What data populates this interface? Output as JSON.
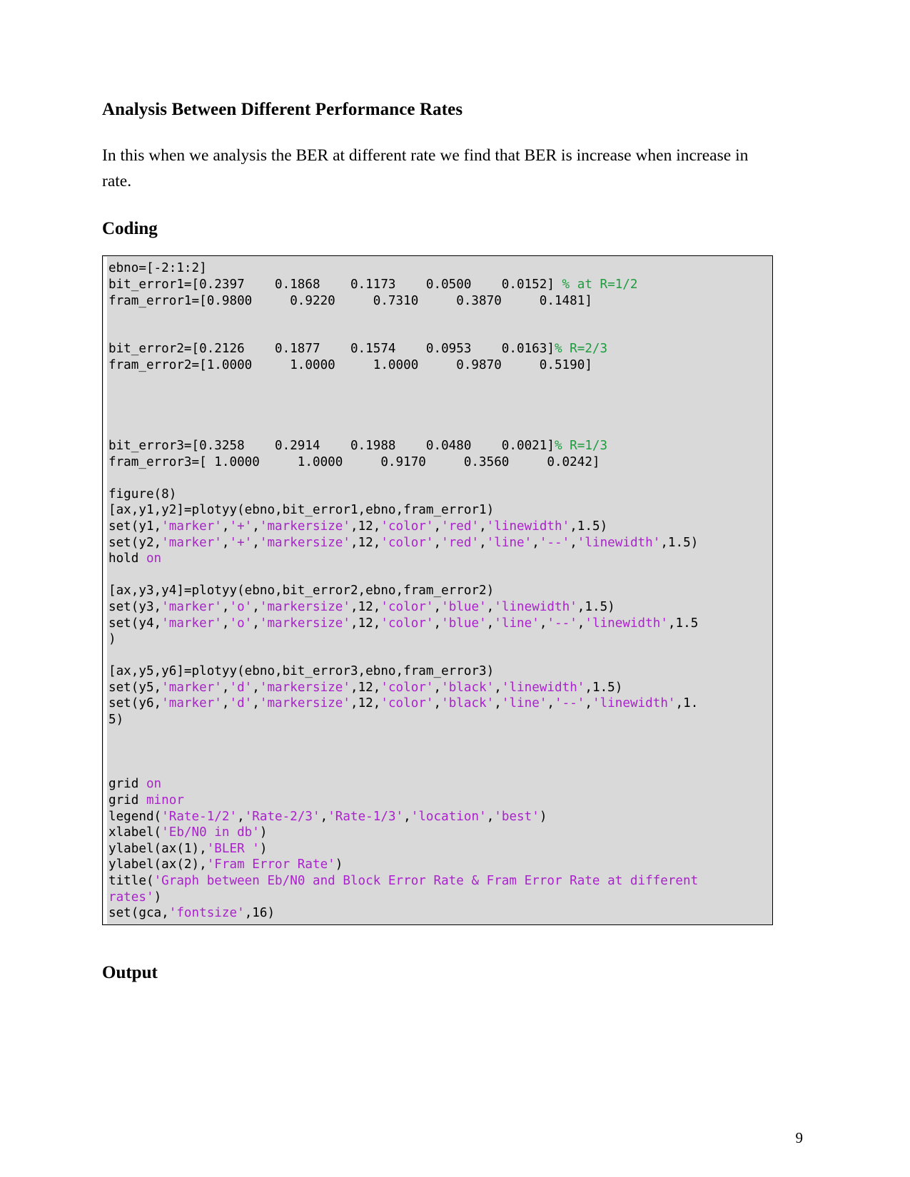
{
  "document": {
    "heading": "Analysis Between Different Performance Rates",
    "paragraph": "In this when we analysis the BER at different rate we find that BER is increase when increase in rate.",
    "coding_heading": "Coding",
    "output_heading": "Output",
    "page_number": "9"
  },
  "code": {
    "language": "matlab",
    "colors": {
      "background": "#d9d9d9",
      "border": "#000000",
      "plain": "#000000",
      "string": "#aa22cc",
      "comment": "#1f9a3f",
      "keyword": "#aa22cc"
    },
    "lines": [
      [
        {
          "t": "ebno=[-2:1:2]",
          "c": "pln"
        }
      ],
      [
        {
          "t": "bit_error1=[0.2397    0.1868    0.1173    0.0500    0.0152] ",
          "c": "pln"
        },
        {
          "t": "% at R=1/2",
          "c": "com"
        }
      ],
      [
        {
          "t": "fram_error1=[0.9800     0.9220     0.7310     0.3870     0.1481]",
          "c": "pln"
        }
      ],
      [
        {
          "t": "",
          "c": "pln"
        }
      ],
      [
        {
          "t": "",
          "c": "pln"
        }
      ],
      [
        {
          "t": "bit_error2=[0.2126    0.1877    0.1574    0.0953    0.0163]",
          "c": "pln"
        },
        {
          "t": "% R=2/3",
          "c": "com"
        }
      ],
      [
        {
          "t": "fram_error2=[1.0000     1.0000     1.0000     0.9870     0.5190]",
          "c": "pln"
        }
      ],
      [
        {
          "t": "",
          "c": "pln"
        }
      ],
      [
        {
          "t": "",
          "c": "pln"
        }
      ],
      [
        {
          "t": "",
          "c": "pln"
        }
      ],
      [
        {
          "t": "",
          "c": "pln"
        }
      ],
      [
        {
          "t": "bit_error3=[0.3258    0.2914    0.1988    0.0480    0.0021]",
          "c": "pln"
        },
        {
          "t": "% R=1/3",
          "c": "com"
        }
      ],
      [
        {
          "t": "fram_error3=[ 1.0000     1.0000     0.9170     0.3560     0.0242]",
          "c": "pln"
        }
      ],
      [
        {
          "t": "",
          "c": "pln"
        }
      ],
      [
        {
          "t": "figure(8)",
          "c": "pln"
        }
      ],
      [
        {
          "t": "[ax,y1,y2]=plotyy(ebno,bit_error1,ebno,fram_error1)",
          "c": "pln"
        }
      ],
      [
        {
          "t": "set(y1,",
          "c": "pln"
        },
        {
          "t": "'marker'",
          "c": "str"
        },
        {
          "t": ",",
          "c": "pln"
        },
        {
          "t": "'+'",
          "c": "str"
        },
        {
          "t": ",",
          "c": "pln"
        },
        {
          "t": "'markersize'",
          "c": "str"
        },
        {
          "t": ",12,",
          "c": "pln"
        },
        {
          "t": "'color'",
          "c": "str"
        },
        {
          "t": ",",
          "c": "pln"
        },
        {
          "t": "'red'",
          "c": "str"
        },
        {
          "t": ",",
          "c": "pln"
        },
        {
          "t": "'linewidth'",
          "c": "str"
        },
        {
          "t": ",1.5)",
          "c": "pln"
        }
      ],
      [
        {
          "t": "set(y2,",
          "c": "pln"
        },
        {
          "t": "'marker'",
          "c": "str"
        },
        {
          "t": ",",
          "c": "pln"
        },
        {
          "t": "'+'",
          "c": "str"
        },
        {
          "t": ",",
          "c": "pln"
        },
        {
          "t": "'markersize'",
          "c": "str"
        },
        {
          "t": ",12,",
          "c": "pln"
        },
        {
          "t": "'color'",
          "c": "str"
        },
        {
          "t": ",",
          "c": "pln"
        },
        {
          "t": "'red'",
          "c": "str"
        },
        {
          "t": ",",
          "c": "pln"
        },
        {
          "t": "'line'",
          "c": "str"
        },
        {
          "t": ",",
          "c": "pln"
        },
        {
          "t": "'--'",
          "c": "str"
        },
        {
          "t": ",",
          "c": "pln"
        },
        {
          "t": "'linewidth'",
          "c": "str"
        },
        {
          "t": ",1.5)",
          "c": "pln"
        }
      ],
      [
        {
          "t": "hold ",
          "c": "pln"
        },
        {
          "t": "on",
          "c": "kw"
        }
      ],
      [
        {
          "t": "",
          "c": "pln"
        }
      ],
      [
        {
          "t": "[ax,y3,y4]=plotyy(ebno,bit_error2,ebno,fram_error2)",
          "c": "pln"
        }
      ],
      [
        {
          "t": "set(y3,",
          "c": "pln"
        },
        {
          "t": "'marker'",
          "c": "str"
        },
        {
          "t": ",",
          "c": "pln"
        },
        {
          "t": "'o'",
          "c": "str"
        },
        {
          "t": ",",
          "c": "pln"
        },
        {
          "t": "'markersize'",
          "c": "str"
        },
        {
          "t": ",12,",
          "c": "pln"
        },
        {
          "t": "'color'",
          "c": "str"
        },
        {
          "t": ",",
          "c": "pln"
        },
        {
          "t": "'blue'",
          "c": "str"
        },
        {
          "t": ",",
          "c": "pln"
        },
        {
          "t": "'linewidth'",
          "c": "str"
        },
        {
          "t": ",1.5)",
          "c": "pln"
        }
      ],
      [
        {
          "t": "set(y4,",
          "c": "pln"
        },
        {
          "t": "'marker'",
          "c": "str"
        },
        {
          "t": ",",
          "c": "pln"
        },
        {
          "t": "'o'",
          "c": "str"
        },
        {
          "t": ",",
          "c": "pln"
        },
        {
          "t": "'markersize'",
          "c": "str"
        },
        {
          "t": ",12,",
          "c": "pln"
        },
        {
          "t": "'color'",
          "c": "str"
        },
        {
          "t": ",",
          "c": "pln"
        },
        {
          "t": "'blue'",
          "c": "str"
        },
        {
          "t": ",",
          "c": "pln"
        },
        {
          "t": "'line'",
          "c": "str"
        },
        {
          "t": ",",
          "c": "pln"
        },
        {
          "t": "'--'",
          "c": "str"
        },
        {
          "t": ",",
          "c": "pln"
        },
        {
          "t": "'linewidth'",
          "c": "str"
        },
        {
          "t": ",1.5",
          "c": "pln"
        }
      ],
      [
        {
          "t": ")",
          "c": "pln"
        }
      ],
      [
        {
          "t": "",
          "c": "pln"
        }
      ],
      [
        {
          "t": "[ax,y5,y6]=plotyy(ebno,bit_error3,ebno,fram_error3)",
          "c": "pln"
        }
      ],
      [
        {
          "t": "set(y5,",
          "c": "pln"
        },
        {
          "t": "'marker'",
          "c": "str"
        },
        {
          "t": ",",
          "c": "pln"
        },
        {
          "t": "'d'",
          "c": "str"
        },
        {
          "t": ",",
          "c": "pln"
        },
        {
          "t": "'markersize'",
          "c": "str"
        },
        {
          "t": ",12,",
          "c": "pln"
        },
        {
          "t": "'color'",
          "c": "str"
        },
        {
          "t": ",",
          "c": "pln"
        },
        {
          "t": "'black'",
          "c": "str"
        },
        {
          "t": ",",
          "c": "pln"
        },
        {
          "t": "'linewidth'",
          "c": "str"
        },
        {
          "t": ",1.5)",
          "c": "pln"
        }
      ],
      [
        {
          "t": "set(y6,",
          "c": "pln"
        },
        {
          "t": "'marker'",
          "c": "str"
        },
        {
          "t": ",",
          "c": "pln"
        },
        {
          "t": "'d'",
          "c": "str"
        },
        {
          "t": ",",
          "c": "pln"
        },
        {
          "t": "'markersize'",
          "c": "str"
        },
        {
          "t": ",12,",
          "c": "pln"
        },
        {
          "t": "'color'",
          "c": "str"
        },
        {
          "t": ",",
          "c": "pln"
        },
        {
          "t": "'black'",
          "c": "str"
        },
        {
          "t": ",",
          "c": "pln"
        },
        {
          "t": "'line'",
          "c": "str"
        },
        {
          "t": ",",
          "c": "pln"
        },
        {
          "t": "'--'",
          "c": "str"
        },
        {
          "t": ",",
          "c": "pln"
        },
        {
          "t": "'linewidth'",
          "c": "str"
        },
        {
          "t": ",1.",
          "c": "pln"
        }
      ],
      [
        {
          "t": "5)",
          "c": "pln"
        }
      ],
      [
        {
          "t": "",
          "c": "pln"
        }
      ],
      [
        {
          "t": "",
          "c": "pln"
        }
      ],
      [
        {
          "t": "",
          "c": "pln"
        }
      ],
      [
        {
          "t": "grid ",
          "c": "pln"
        },
        {
          "t": "on",
          "c": "kw"
        }
      ],
      [
        {
          "t": "grid ",
          "c": "pln"
        },
        {
          "t": "minor",
          "c": "kw"
        }
      ],
      [
        {
          "t": "legend(",
          "c": "pln"
        },
        {
          "t": "'Rate-1/2'",
          "c": "str"
        },
        {
          "t": ",",
          "c": "pln"
        },
        {
          "t": "'Rate-2/3'",
          "c": "str"
        },
        {
          "t": ",",
          "c": "pln"
        },
        {
          "t": "'Rate-1/3'",
          "c": "str"
        },
        {
          "t": ",",
          "c": "pln"
        },
        {
          "t": "'location'",
          "c": "str"
        },
        {
          "t": ",",
          "c": "pln"
        },
        {
          "t": "'best'",
          "c": "str"
        },
        {
          "t": ")",
          "c": "pln"
        }
      ],
      [
        {
          "t": "xlabel(",
          "c": "pln"
        },
        {
          "t": "'Eb/N0 in db'",
          "c": "str"
        },
        {
          "t": ")",
          "c": "pln"
        }
      ],
      [
        {
          "t": "ylabel(ax(1),",
          "c": "pln"
        },
        {
          "t": "'BLER '",
          "c": "str"
        },
        {
          "t": ")",
          "c": "pln"
        }
      ],
      [
        {
          "t": "ylabel(ax(2),",
          "c": "pln"
        },
        {
          "t": "'Fram Error Rate'",
          "c": "str"
        },
        {
          "t": ")",
          "c": "pln"
        }
      ],
      [
        {
          "t": "title(",
          "c": "pln"
        },
        {
          "t": "'Graph between Eb/N0 and Block Error Rate & Fram Error Rate at different",
          "c": "str"
        }
      ],
      [
        {
          "t": "rates'",
          "c": "str"
        },
        {
          "t": ")",
          "c": "pln"
        }
      ],
      [
        {
          "t": "set(gca,",
          "c": "pln"
        },
        {
          "t": "'fontsize'",
          "c": "str"
        },
        {
          "t": ",16)",
          "c": "pln"
        }
      ]
    ]
  },
  "chart_data": {
    "type": "line",
    "title": "Graph between Eb/N0 and Block Error Rate & Fram Error Rate at different rates",
    "xlabel": "Eb/N0 in db",
    "ylabel": "BLER ",
    "ylabel_right": "Fram Error Rate",
    "x": [
      -2,
      -1,
      0,
      1,
      2
    ],
    "legend": [
      "Rate-1/2",
      "Rate-2/3",
      "Rate-1/3"
    ],
    "legend_location": "best",
    "grid": true,
    "grid_minor": true,
    "series": [
      {
        "name": "bit_error1",
        "rate": "R=1/2",
        "axis": "left",
        "marker": "+",
        "color": "red",
        "linestyle": "-",
        "values": [
          0.2397,
          0.1868,
          0.1173,
          0.05,
          0.0152
        ]
      },
      {
        "name": "fram_error1",
        "rate": "R=1/2",
        "axis": "right",
        "marker": "+",
        "color": "red",
        "linestyle": "--",
        "values": [
          0.98,
          0.922,
          0.731,
          0.387,
          0.1481
        ]
      },
      {
        "name": "bit_error2",
        "rate": "R=2/3",
        "axis": "left",
        "marker": "o",
        "color": "blue",
        "linestyle": "-",
        "values": [
          0.2126,
          0.1877,
          0.1574,
          0.0953,
          0.0163
        ]
      },
      {
        "name": "fram_error2",
        "rate": "R=2/3",
        "axis": "right",
        "marker": "o",
        "color": "blue",
        "linestyle": "--",
        "values": [
          1.0,
          1.0,
          1.0,
          0.987,
          0.519
        ]
      },
      {
        "name": "bit_error3",
        "rate": "R=1/3",
        "axis": "left",
        "marker": "d",
        "color": "black",
        "linestyle": "-",
        "values": [
          0.3258,
          0.2914,
          0.1988,
          0.048,
          0.0021
        ]
      },
      {
        "name": "fram_error3",
        "rate": "R=1/3",
        "axis": "right",
        "marker": "d",
        "color": "black",
        "linestyle": "--",
        "values": [
          1.0,
          1.0,
          0.917,
          0.356,
          0.0242
        ]
      }
    ]
  }
}
